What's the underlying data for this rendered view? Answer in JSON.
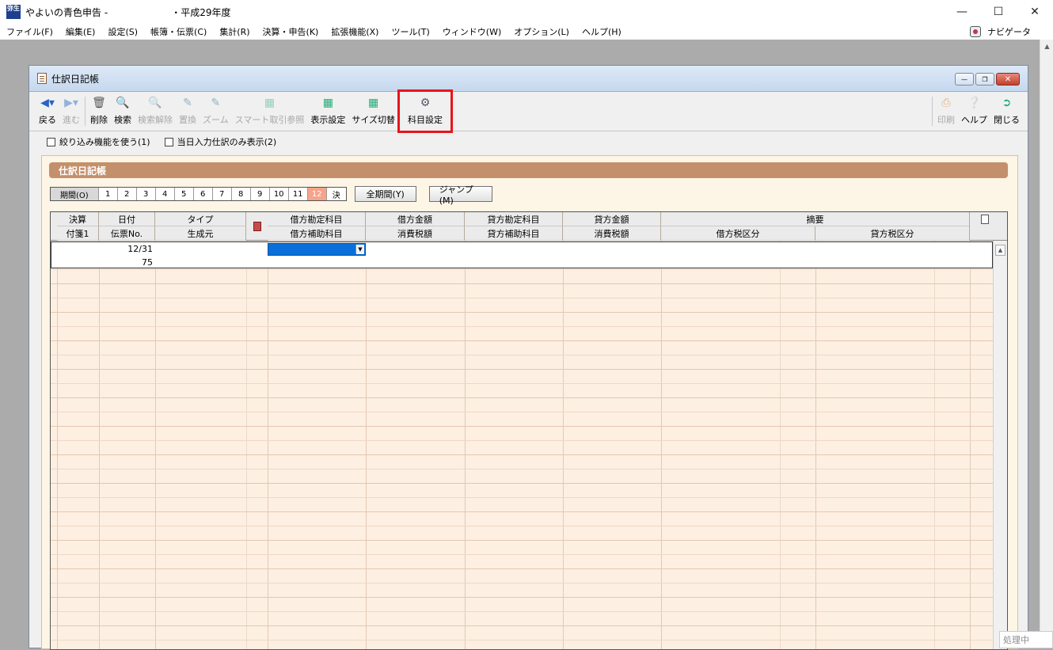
{
  "app": {
    "title": "やよいの青色申告 -                     ・平成29年度",
    "icon_text": "弥生",
    "status": "処理中"
  },
  "menu": [
    "ファイル(F)",
    "編集(E)",
    "設定(S)",
    "帳簿・伝票(C)",
    "集計(R)",
    "決算・申告(K)",
    "拡張機能(X)",
    "ツール(T)",
    "ウィンドウ(W)",
    "オプション(L)",
    "ヘルプ(H)"
  ],
  "navigator": "ナビゲータ",
  "journal": {
    "title": "仕訳日記帳",
    "toolbar": {
      "back": "戻る",
      "forward": "進む",
      "delete": "削除",
      "search": "検索",
      "search_clear": "検索解除",
      "replace": "置換",
      "zoom": "ズーム",
      "smart": "スマート取引参照",
      "display": "表示設定",
      "size": "サイズ切替",
      "account": "科目設定",
      "print": "印刷",
      "help": "ヘルプ",
      "close": "閉じる"
    },
    "options": {
      "filter": "絞り込み機能を使う(1)",
      "today_only": "当日入力仕訳のみ表示(2)"
    },
    "panel_title": "仕訳日記帳",
    "period_label": "期間(O)",
    "periods": [
      "1",
      "2",
      "3",
      "4",
      "5",
      "6",
      "7",
      "8",
      "9",
      "10",
      "11",
      "12",
      "決"
    ],
    "active_period": "12",
    "all_period_button": "全期間(Y)",
    "jump_button": "ジャンプ(M)",
    "headers": {
      "row1": [
        "決算",
        "日付",
        "タイプ",
        "借方勘定科目",
        "借方金額",
        "貸方勘定科目",
        "貸方金額",
        "摘要"
      ],
      "row2": [
        "付箋1",
        "伝票No.",
        "生成元",
        "借方補助科目",
        "消費税額",
        "貸方補助科目",
        "消費税額",
        "借方税区分",
        "貸方税区分"
      ]
    },
    "entry": {
      "date": "12/31",
      "slip_no": "75"
    }
  }
}
